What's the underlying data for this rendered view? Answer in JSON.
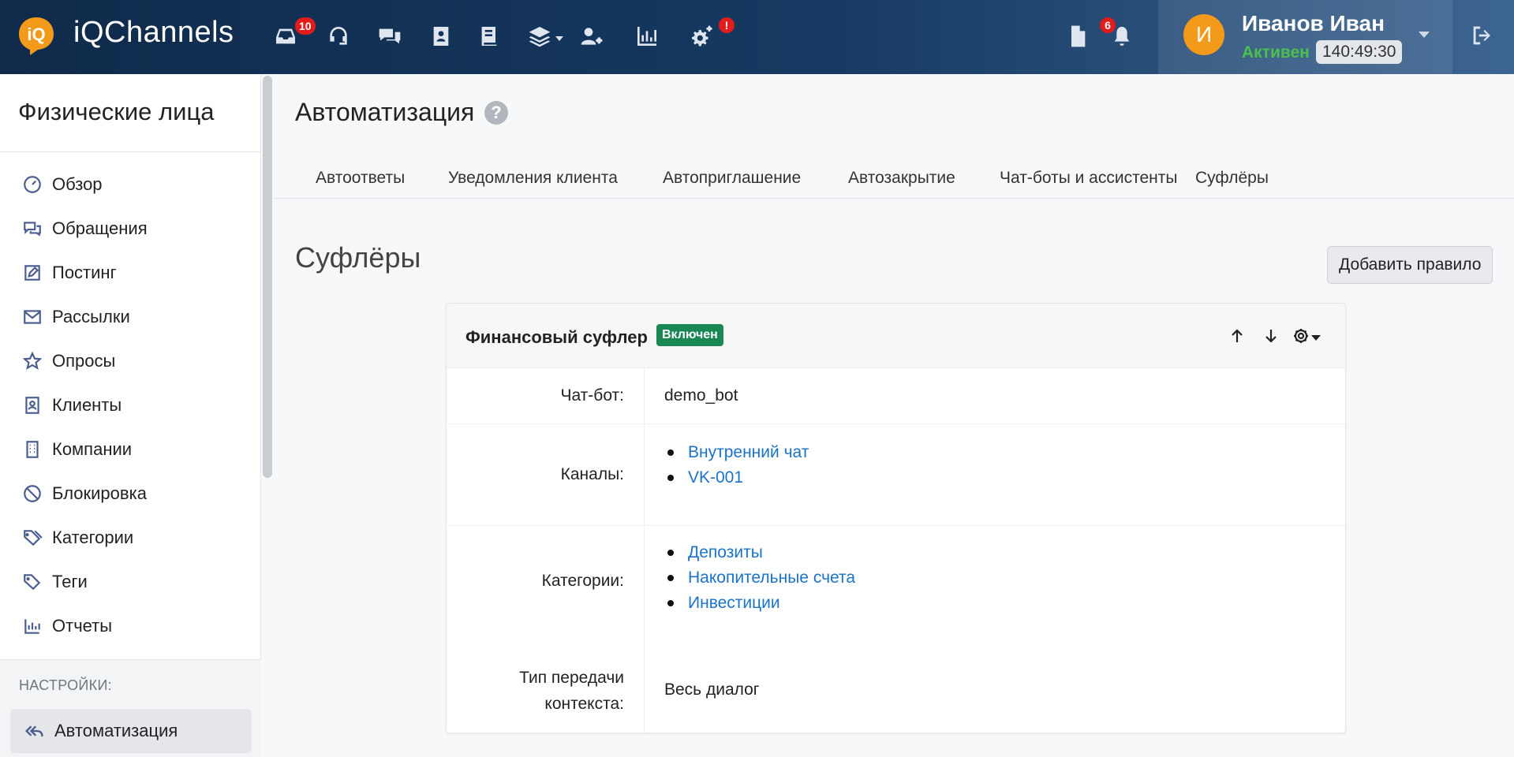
{
  "app": {
    "name": "iQChannels",
    "logo_text": "iQ"
  },
  "topnav": {
    "inbox_badge": "10",
    "settings_alert": "!",
    "notifications_badge": "6"
  },
  "user": {
    "initial": "И",
    "name": "Иванов Иван",
    "status": "Активен",
    "timer": "140:49:30"
  },
  "sidebar": {
    "title": "Физические лица",
    "items": [
      {
        "label": "Обзор",
        "icon": "gauge-icon"
      },
      {
        "label": "Обращения",
        "icon": "chat-icon"
      },
      {
        "label": "Постинг",
        "icon": "edit-icon"
      },
      {
        "label": "Рассылки",
        "icon": "mail-icon"
      },
      {
        "label": "Опросы",
        "icon": "star-icon"
      },
      {
        "label": "Клиенты",
        "icon": "contact-icon"
      },
      {
        "label": "Компании",
        "icon": "building-icon"
      },
      {
        "label": "Блокировка",
        "icon": "ban-icon"
      },
      {
        "label": "Категории",
        "icon": "tags-icon"
      },
      {
        "label": "Теги",
        "icon": "tag-icon"
      },
      {
        "label": "Отчеты",
        "icon": "chart-icon"
      }
    ],
    "settings_label": "НАСТРОЙКИ:",
    "active_item": "Автоматизация"
  },
  "main": {
    "title": "Автоматизация",
    "help": "?",
    "tabs": [
      "Автоответы",
      "Уведомления клиента",
      "Автоприглашение",
      "Автозакрытие",
      "Чат-боты и ассистенты",
      "Суфлёры"
    ],
    "section_title": "Суфлёры",
    "add_button": "Добавить правило",
    "card": {
      "title": "Финансовый суфлер",
      "status": "Включен",
      "rows": {
        "chatbot_label": "Чат-бот:",
        "chatbot_value": "demo_bot",
        "channels_label": "Каналы:",
        "channels": [
          "Внутренний чат",
          "VK-001"
        ],
        "categories_label": "Категории:",
        "categories": [
          "Депозиты",
          "Накопительные счета",
          "Инвестиции"
        ],
        "context_label_1": "Тип передачи",
        "context_label_2": "контекста:",
        "context_value": "Весь диалог"
      }
    }
  },
  "colors": {
    "topbar": "#163a62",
    "accent": "#f39a1a",
    "status_green": "#198754",
    "link": "#1a73c9"
  }
}
